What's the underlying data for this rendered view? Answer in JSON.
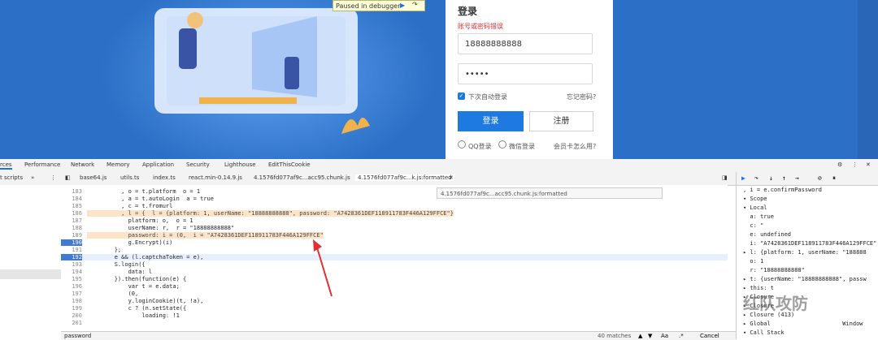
{
  "page": {
    "debugger_banner": "Paused in debugger",
    "login_title": "登录",
    "error_text": "账号或密码错误",
    "phone_value": "18888888888",
    "password_mask": "•••••",
    "auto_login_label": "下次自动登录",
    "forgot_label": "忘记密码?",
    "login_button": "登录",
    "register_button": "注册",
    "qq_login": "QQ登录",
    "wechat_login": "微信登录",
    "member_card": "会员卡怎么用?"
  },
  "devtools": {
    "tabs": [
      "rces",
      "Performance",
      "Network",
      "Memory",
      "Application",
      "Security",
      "Lighthouse",
      "EditThisCookie"
    ],
    "file_tabs": [
      "base64.js",
      "utils.ts",
      "index.ts",
      "react.min-0.14.9.js",
      "4.1576fd077af9c...acc95.chunk.js",
      "4.1576fd077af9c...k.js:formatted"
    ],
    "left_nav_label": "t scripts",
    "tooltip": "4.1576fd077af9c...acc95.chunk.js:formatted",
    "code_lines": [
      {
        "n": "183",
        "t": "          , o = t.platform  o = 1",
        "hl": false
      },
      {
        "n": "184",
        "t": "          , a = t.autoLogin  a = true",
        "hl": false
      },
      {
        "n": "185",
        "t": "          , c = t.fromurl",
        "hl": false
      },
      {
        "n": "186",
        "t": "          , l = {  l = {platform: 1, userName: \"18888888888\", password: \"A7428361DEF118911783F446A129FFCE\"}",
        "hl": true
      },
      {
        "n": "187",
        "t": "            platform: o,  o = 1",
        "hl": false
      },
      {
        "n": "188",
        "t": "            userName: r,  r = \"18888888888\"",
        "hl": false
      },
      {
        "n": "189",
        "t": "            password: i = (0,  i = \"A7428361DEF118911783F446A129FFCE\"",
        "hl": true
      },
      {
        "n": "190",
        "t": "            g.Encrypt)(i)",
        "hl": false
      },
      {
        "n": "191",
        "t": "        };",
        "hl": false
      },
      {
        "n": "192",
        "t": "        e && (l.captchaToken = e),",
        "hl": false
      },
      {
        "n": "193",
        "t": "        S.login({",
        "hl": false
      },
      {
        "n": "194",
        "t": "            data: l",
        "hl": false
      },
      {
        "n": "195",
        "t": "        }).then(function(e) {",
        "hl": false
      },
      {
        "n": "196",
        "t": "            var t = e.data;",
        "hl": false
      },
      {
        "n": "197",
        "t": "            (0,",
        "hl": false
      },
      {
        "n": "198",
        "t": "            y.loginCookie)(t, !a),",
        "hl": false
      },
      {
        "n": "199",
        "t": "            c ? (n.setState({",
        "hl": false
      },
      {
        "n": "200",
        "t": "                loading: !1",
        "hl": false
      },
      {
        "n": "201",
        "t": "",
        "hl": false
      }
    ],
    "right_lines": [
      {
        "t": ", i = e.confirmPassword"
      },
      {
        "t": "▾ Scope"
      },
      {
        "t": "▾ Local"
      },
      {
        "t": "  a: true"
      },
      {
        "t": "  c: \""
      },
      {
        "t": "  e: undefined"
      },
      {
        "t": "  i: \"A7428361DEF118911783F446A129FFCE\""
      },
      {
        "t": "▸ l: {platform: 1, userName: \"188888"
      },
      {
        "t": "  o: 1"
      },
      {
        "t": "  r: \"18888888888\""
      },
      {
        "t": "▸ t: {userName: \"18888888888\", passw"
      },
      {
        "t": "▸ this: t"
      },
      {
        "t": "▸ Closure"
      },
      {
        "t": "▸ Closure"
      },
      {
        "t": "▸ Closure (413)"
      },
      {
        "t": "▸ Global                     Window"
      },
      {
        "t": "▾ Call Stack"
      }
    ],
    "search_value": "password",
    "matches": "40 matches",
    "cancel": "Cancel",
    "aa": "Aa",
    "regex": ".*"
  },
  "watermark": "红队攻防",
  "colors": {
    "page_bg": "#2b6fc6",
    "primary_button": "#1e7ae0",
    "highlight": "#fde3c8",
    "arrow": "#e23030"
  }
}
